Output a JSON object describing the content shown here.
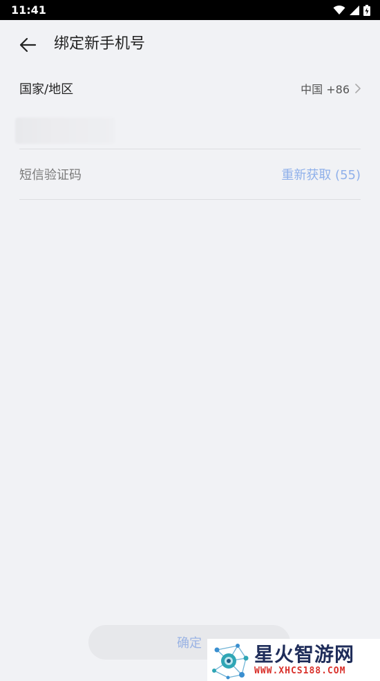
{
  "status_bar": {
    "time": "11:41"
  },
  "header": {
    "title": "绑定新手机号"
  },
  "region": {
    "label": "国家/地区",
    "value": "中国 +86"
  },
  "sms": {
    "label": "短信验证码",
    "resend_label": "重新获取 (55)"
  },
  "confirm": {
    "label": "确定"
  },
  "watermark": {
    "title": "星火智游网",
    "url": "WWW.XHCS188.COM"
  },
  "colors": {
    "accent": "#8fb0ea",
    "background": "#f1f2f5",
    "watermark_red": "#d9302a"
  }
}
